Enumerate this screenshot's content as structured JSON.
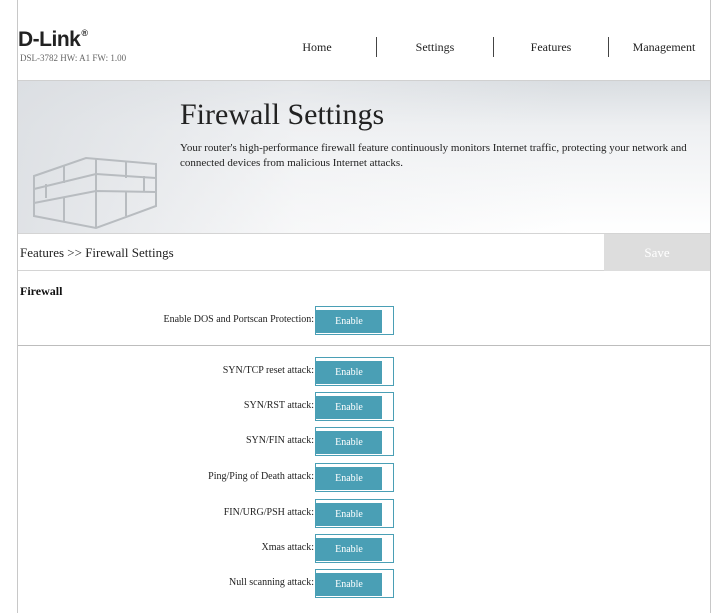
{
  "brand": {
    "logo": "D-Link",
    "model_info": "DSL-3782  HW: A1  FW: 1.00"
  },
  "nav": [
    {
      "label": "Home"
    },
    {
      "label": "Settings"
    },
    {
      "label": "Features"
    },
    {
      "label": "Management"
    }
  ],
  "banner": {
    "title": "Firewall Settings",
    "description": "Your router's high-performance firewall feature continuously monitors Internet traffic, protecting your network and connected devices from malicious Internet attacks."
  },
  "breadcrumb": "Features >> Firewall Settings",
  "save_label": "Save",
  "colors": {
    "accent": "#4a9fb5",
    "save_disabled": "#dddddd"
  },
  "firewall": {
    "section_title": "Firewall",
    "main": {
      "label": "Enable DOS and Portscan Protection:",
      "state": "Enable"
    },
    "attacks": [
      {
        "label": "SYN/TCP reset attack:",
        "state": "Enable"
      },
      {
        "label": "SYN/RST attack:",
        "state": "Enable"
      },
      {
        "label": "SYN/FIN attack:",
        "state": "Enable"
      },
      {
        "label": "Ping/Ping of Death attack:",
        "state": "Enable"
      },
      {
        "label": "FIN/URG/PSH attack:",
        "state": "Enable"
      },
      {
        "label": "Xmas attack:",
        "state": "Enable"
      },
      {
        "label": "Null scanning attack:",
        "state": "Enable"
      }
    ]
  }
}
